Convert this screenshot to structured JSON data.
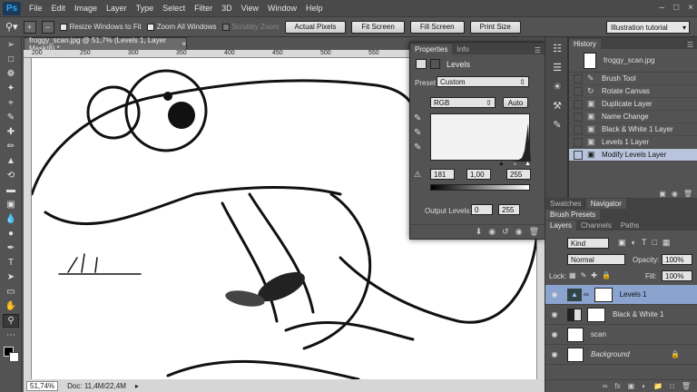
{
  "app": {
    "logo": "Ps"
  },
  "menu": [
    "File",
    "Edit",
    "Image",
    "Layer",
    "Type",
    "Select",
    "Filter",
    "3D",
    "View",
    "Window",
    "Help"
  ],
  "window_controls": [
    "–",
    "□",
    "×"
  ],
  "options_bar": {
    "resize_windows": "Resize Windows to Fit",
    "zoom_all": "Zoom All Windows",
    "scrubby_zoom": "Scrubby Zoom",
    "actual_pixels": "Actual Pixels",
    "fit_screen": "Fit Screen",
    "fill_screen": "Fill Screen",
    "print_size": "Print Size",
    "workspace": "Illustration tutorial"
  },
  "document": {
    "tab_title": "froggy_scan.jpg @ 51,7% (Levels 1, Layer Mask/8) *",
    "ruler_marks": [
      "200",
      "250",
      "300",
      "350",
      "400",
      "450",
      "500",
      "550",
      "600",
      "650"
    ],
    "zoom": "51,74%",
    "doc_info": "Doc: 11,4M/22,4M"
  },
  "properties": {
    "tabs": [
      "Properties",
      "Info"
    ],
    "title": "Levels",
    "preset_label": "Preset:",
    "preset_value": "Custom",
    "channel": "RGB",
    "auto_label": "Auto",
    "input_levels": [
      "181",
      "1,00",
      "255"
    ],
    "output_label": "Output Levels:",
    "output_levels": [
      "0",
      "255"
    ]
  },
  "history": {
    "tab": "History",
    "snapshot": "froggy_scan.jpg",
    "items": [
      {
        "label": "Brush Tool",
        "icon": "brush-icon"
      },
      {
        "label": "Rotate Canvas",
        "icon": "rotate-icon"
      },
      {
        "label": "Duplicate Layer",
        "icon": "layer-icon"
      },
      {
        "label": "Name Change",
        "icon": "layer-icon"
      },
      {
        "label": "Black & White 1 Layer",
        "icon": "layer-icon"
      },
      {
        "label": "Levels 1 Layer",
        "icon": "layer-icon"
      },
      {
        "label": "Modify Levels Layer",
        "icon": "layer-icon"
      }
    ]
  },
  "panel_tabs": {
    "swatches": "Swatches",
    "navigator": "Navigator",
    "brush_presets": "Brush Presets",
    "layers": "Layers",
    "channels": "Channels",
    "paths": "Paths"
  },
  "layers_panel": {
    "kind": "Kind",
    "blend": "Normal",
    "opacity_label": "Opacity:",
    "opacity": "100%",
    "lock_label": "Lock:",
    "fill_label": "Fill:",
    "fill": "100%",
    "layers": [
      {
        "name": "Levels 1",
        "selected": true
      },
      {
        "name": "Black & White 1",
        "selected": false
      },
      {
        "name": "scan",
        "selected": false
      },
      {
        "name": "Background",
        "selected": false
      }
    ]
  },
  "colors": {
    "foreground": "#000000",
    "background": "#ffffff",
    "selection": "#b7c4dc"
  }
}
